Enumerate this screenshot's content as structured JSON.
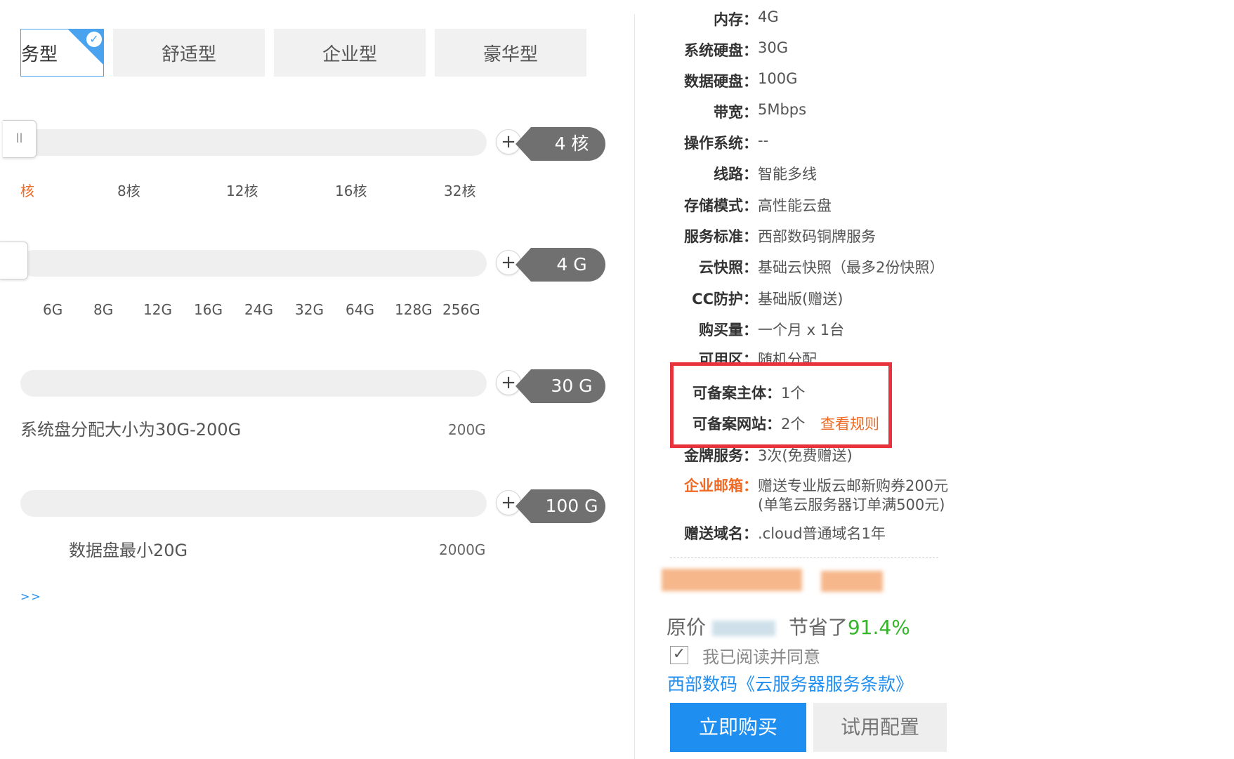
{
  "tabs": [
    {
      "label": "务型",
      "active": true
    },
    {
      "label": "舒适型",
      "active": false
    },
    {
      "label": "企业型",
      "active": false
    },
    {
      "label": "豪华型",
      "active": false
    }
  ],
  "cpu": {
    "value": "4 核",
    "ticks": [
      "核",
      "8核",
      "12核",
      "16核",
      "32核"
    ]
  },
  "memory": {
    "value": "4 G",
    "ticks": [
      "6G",
      "8G",
      "12G",
      "16G",
      "24G",
      "32G",
      "64G",
      "128G",
      "256G"
    ]
  },
  "system_disk": {
    "value": "30 G",
    "hint": "系统盘分配大小为30G-200G",
    "max": "200G"
  },
  "data_disk": {
    "value": "100 G",
    "hint": "数据盘最小20G",
    "max": "2000G"
  },
  "more_link": ">>",
  "summary": [
    {
      "key": "内存：",
      "value": "4G"
    },
    {
      "key": "系统硬盘：",
      "value": "30G"
    },
    {
      "key": "数据硬盘：",
      "value": "100G"
    },
    {
      "key": "带宽：",
      "value": "5Mbps"
    },
    {
      "key": "操作系统：",
      "value": "--"
    },
    {
      "key": "线路：",
      "value": "智能多线"
    },
    {
      "key": "存储模式：",
      "value": "高性能云盘"
    },
    {
      "key": "服务标准：",
      "value": "西部数码铜牌服务"
    },
    {
      "key": "云快照：",
      "value": "基础云快照（最多2份快照）"
    },
    {
      "key": "CC防护：",
      "value": "基础版(赠送)"
    },
    {
      "key": "购买量：",
      "value": "一个月 x 1台"
    },
    {
      "key": "可用区：",
      "value": "随机分配"
    }
  ],
  "icp": {
    "subject_key": "可备案主体：",
    "subject_value": "1个",
    "site_key": "可备案网站：",
    "site_value": "2个",
    "rules_link": "查看规则"
  },
  "extras": {
    "gold_key": "金牌服务：",
    "gold_value": "3次(免费赠送)",
    "email_key": "企业邮箱：",
    "email_line1": "赠送专业版云邮新购券200元",
    "email_line2": "(单笔云服务器订单满500元)",
    "domain_key": "赠送域名：",
    "domain_value": ".cloud普通域名1年"
  },
  "price": {
    "original_prefix": "原价",
    "saved_prefix": "节省了",
    "saved_percent": "91.4%"
  },
  "agreement": {
    "checkbox_label": "我已阅读并同意",
    "checked": true,
    "terms_link": "西部数码《云服务器服务条款》"
  },
  "buttons": {
    "buy": "立即购买",
    "trial": "试用配置"
  },
  "colors": {
    "accent_blue": "#1f8ef1",
    "highlight_red": "#e8323c",
    "orange": "#f06a23",
    "green": "#35b52a",
    "tag_gray": "#707070"
  }
}
